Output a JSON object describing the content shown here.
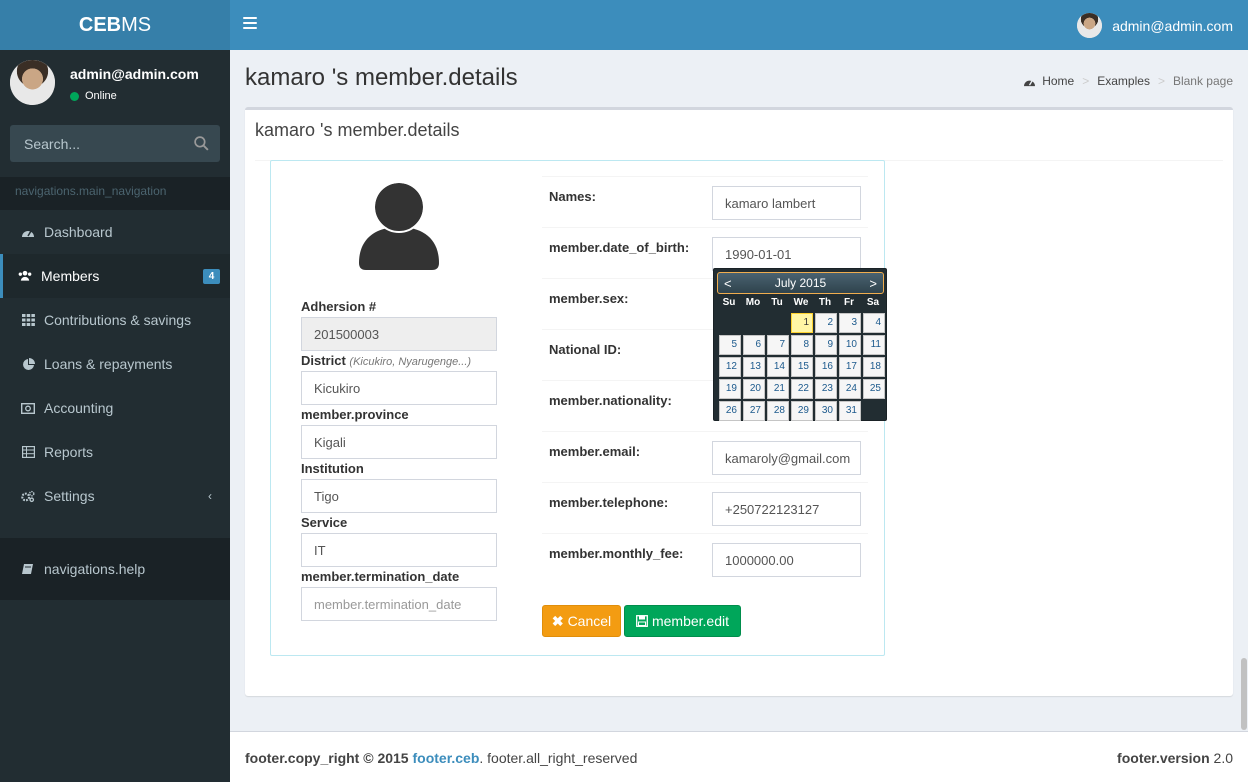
{
  "brand": {
    "bold": "CEB",
    "rest": "MS"
  },
  "topbar": {
    "user_email": "admin@admin.com"
  },
  "user_panel": {
    "name": "admin@admin.com",
    "status": "Online"
  },
  "search": {
    "placeholder": "Search..."
  },
  "nav_header": "navigations.main_navigation",
  "menu": [
    {
      "label": "Dashboard",
      "icon": "dashboard-icon"
    },
    {
      "label": "Members",
      "icon": "users-icon",
      "badge": "4"
    },
    {
      "label": "Contributions & savings",
      "icon": "grid-icon"
    },
    {
      "label": "Loans & repayments",
      "icon": "pie-chart-icon"
    },
    {
      "label": "Accounting",
      "icon": "money-icon"
    },
    {
      "label": "Reports",
      "icon": "table-icon"
    },
    {
      "label": "Settings",
      "icon": "cogs-icon"
    }
  ],
  "help": {
    "label": "navigations.help",
    "icon": "book-icon"
  },
  "page": {
    "title": "kamaro 's member.details"
  },
  "breadcrumb": {
    "home": "Home",
    "examples": "Examples",
    "current": "Blank page"
  },
  "box": {
    "title": "kamaro 's member.details"
  },
  "left_form": {
    "adhersion_label": "Adhersion #",
    "adhersion_value": "201500003",
    "district_label": "District",
    "district_hint": "(Kicukiro, Nyarugenge...)",
    "district_value": "Kicukiro",
    "province_label": "member.province",
    "province_value": "Kigali",
    "institution_label": "Institution",
    "institution_value": "Tigo",
    "service_label": "Service",
    "service_value": "IT",
    "termination_label": "member.termination_date",
    "termination_placeholder": "member.termination_date"
  },
  "right_form": {
    "names_label": "Names:",
    "names_value": "kamaro lambert",
    "dob_label": "member.date_of_birth:",
    "dob_value": "1990-01-01",
    "sex_label": "member.sex:",
    "national_id_label": "National ID:",
    "nationality_label": "member.nationality:",
    "email_label": "member.email:",
    "email_value": "kamaroly@gmail.com",
    "telephone_label": "member.telephone:",
    "telephone_value": "+250722123127",
    "fee_label": "member.monthly_fee:",
    "fee_value": "1000000.00"
  },
  "buttons": {
    "cancel": "Cancel",
    "edit": "member.edit"
  },
  "calendar": {
    "prev": "<",
    "next": ">",
    "month": "July 2015",
    "weekdays": [
      "Su",
      "Mo",
      "Tu",
      "We",
      "Th",
      "Fr",
      "Sa"
    ],
    "days": [
      "",
      "",
      "",
      "1",
      "2",
      "3",
      "4",
      "5",
      "6",
      "7",
      "8",
      "9",
      "10",
      "11",
      "12",
      "13",
      "14",
      "15",
      "16",
      "17",
      "18",
      "19",
      "20",
      "21",
      "22",
      "23",
      "24",
      "25",
      "26",
      "27",
      "28",
      "29",
      "30",
      "31",
      ""
    ],
    "highlighted_day": "1"
  },
  "footer": {
    "copy_label": "footer.copy_right © 2015",
    "company": "footer.ceb",
    "rights": ". footer.all_right_reserved",
    "version_label": "footer.version",
    "version": "2.0"
  }
}
